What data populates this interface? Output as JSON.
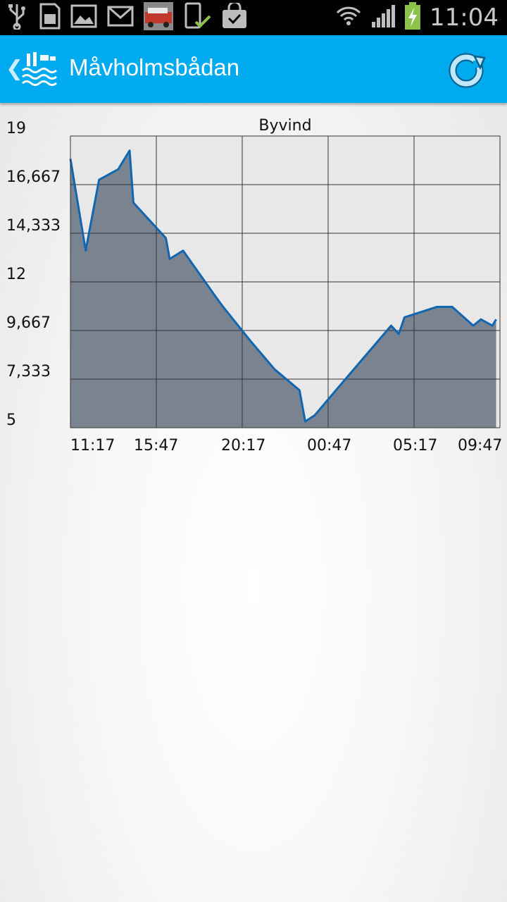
{
  "status_bar": {
    "time": "11:04",
    "icons_left": [
      "usb-icon",
      "sd-card-icon",
      "image-icon",
      "gmail-icon",
      "photo-thumbnail-icon",
      "device-check-icon",
      "shopping-bag-icon"
    ],
    "icons_right": [
      "wifi-icon",
      "signal-icon",
      "battery-charging-icon"
    ]
  },
  "action_bar": {
    "title": "Måvholmsbådan",
    "back_icon": "chevron-left-icon",
    "logo_icon": "weather-station-icon",
    "refresh_icon": "refresh-icon",
    "color": "#00aaee"
  },
  "chart_data": {
    "type": "area",
    "title": "Byvind",
    "x_tick_labels": [
      "11:17",
      "15:47",
      "20:17",
      "00:47",
      "05:17",
      "09:47"
    ],
    "y_tick_labels": [
      "19",
      "16,667",
      "14,333",
      "12",
      "9,667",
      "7,333",
      "5"
    ],
    "ylim": [
      5,
      19
    ],
    "grid": true,
    "line_color": "#1166b0",
    "fill_color": "#7a8491",
    "series": [
      {
        "values": [
          [
            0.0,
            17.9
          ],
          [
            0.8,
            13.5
          ],
          [
            1.5,
            16.9
          ],
          [
            2.5,
            17.4
          ],
          [
            3.1,
            18.3
          ],
          [
            3.3,
            15.8
          ],
          [
            5.0,
            14.1
          ],
          [
            5.2,
            13.1
          ],
          [
            5.9,
            13.5
          ],
          [
            7.6,
            11.3
          ],
          [
            8.0,
            10.8
          ],
          [
            9.4,
            9.2
          ],
          [
            10.7,
            7.8
          ],
          [
            12.0,
            6.8
          ],
          [
            12.3,
            5.3
          ],
          [
            12.8,
            5.6
          ],
          [
            14.0,
            6.9
          ],
          [
            16.8,
            9.9
          ],
          [
            17.2,
            9.5
          ],
          [
            17.5,
            10.3
          ],
          [
            19.2,
            10.8
          ],
          [
            20.0,
            10.8
          ],
          [
            21.1,
            9.9
          ],
          [
            21.5,
            10.2
          ],
          [
            22.1,
            9.9
          ],
          [
            22.3,
            10.2
          ]
        ]
      }
    ]
  }
}
